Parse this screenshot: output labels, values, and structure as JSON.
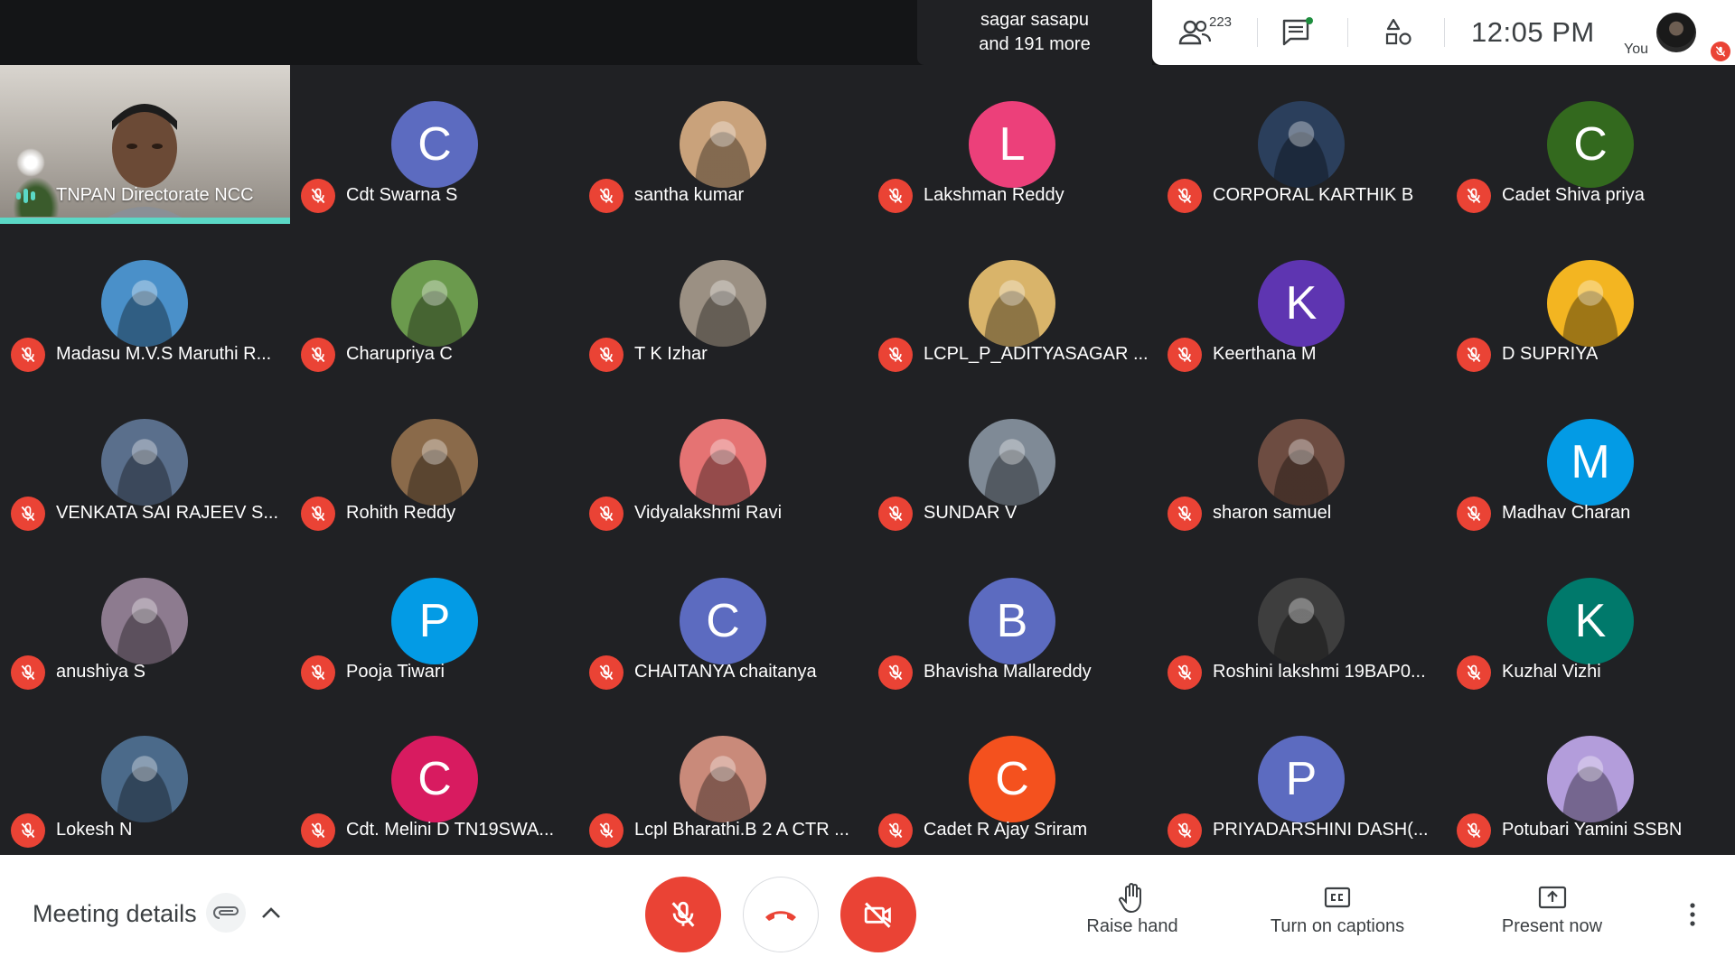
{
  "topbar": {
    "presenter_line1": "sagar sasapu",
    "presenter_line2": "and 191 more",
    "people_count": "223",
    "time": "12:05  PM",
    "you_label": "You",
    "icons": [
      "people-icon",
      "chat-icon",
      "activities-icon"
    ]
  },
  "self_tile": {
    "name": "TNPAN Directorate NCC"
  },
  "participants": [
    {
      "name": "Cdt Swarna S",
      "initial": "C",
      "color": "#5c6bc0"
    },
    {
      "name": "santha kumar",
      "initial": "",
      "color": "#c9a27b"
    },
    {
      "name": "Lakshman Reddy",
      "initial": "L",
      "color": "#ec407a"
    },
    {
      "name": "CORPORAL KARTHIK B",
      "initial": "",
      "color": "#2b3f5c"
    },
    {
      "name": "Cadet Shiva priya",
      "initial": "C",
      "color": "#33691e"
    },
    {
      "name": "Madasu M.V.S Maruthi R...",
      "initial": "",
      "color": "#4a90c9"
    },
    {
      "name": "Charupriya C",
      "initial": "",
      "color": "#6b9a4d"
    },
    {
      "name": "T K Izhar",
      "initial": "",
      "color": "#9b9083"
    },
    {
      "name": "LCPL_P_ADITYASAGAR ...",
      "initial": "",
      "color": "#d9b46a"
    },
    {
      "name": "Keerthana M",
      "initial": "K",
      "color": "#5e35b1"
    },
    {
      "name": "D SUPRIYA",
      "initial": "",
      "color": "#f3b521"
    },
    {
      "name": "VENKATA SAI RAJEEV S...",
      "initial": "",
      "color": "#5a6f8c"
    },
    {
      "name": "Rohith Reddy",
      "initial": "",
      "color": "#8a6a4a"
    },
    {
      "name": "Vidyalakshmi Ravi",
      "initial": "",
      "color": "#e57373"
    },
    {
      "name": "SUNDAR V",
      "initial": "",
      "color": "#7f8a96"
    },
    {
      "name": "sharon samuel",
      "initial": "",
      "color": "#6d4c41"
    },
    {
      "name": "Madhav Charan",
      "initial": "M",
      "color": "#039be5"
    },
    {
      "name": "anushiya S",
      "initial": "",
      "color": "#8d7b8f"
    },
    {
      "name": "Pooja Tiwari",
      "initial": "P",
      "color": "#039be5"
    },
    {
      "name": "CHAITANYA chaitanya",
      "initial": "C",
      "color": "#5c6bc0"
    },
    {
      "name": "Bhavisha Mallareddy",
      "initial": "B",
      "color": "#5c6bc0"
    },
    {
      "name": "Roshini lakshmi 19BAP0...",
      "initial": "",
      "color": "#3e3e3e"
    },
    {
      "name": "Kuzhal Vizhi",
      "initial": "K",
      "color": "#00796b"
    },
    {
      "name": "Lokesh N",
      "initial": "",
      "color": "#4b6a8a"
    },
    {
      "name": "Cdt. Melini D TN19SWA...",
      "initial": "C",
      "color": "#d81b60"
    },
    {
      "name": "Lcpl Bharathi.B 2 A CTR ...",
      "initial": "",
      "color": "#c98a7a"
    },
    {
      "name": "Cadet R Ajay Sriram",
      "initial": "C",
      "color": "#f4511e"
    },
    {
      "name": "PRIYADARSHINI DASH(...",
      "initial": "P",
      "color": "#5c6bc0"
    },
    {
      "name": "Potubari Yamini SSBN",
      "initial": "",
      "color": "#b39ddb"
    }
  ],
  "bottombar": {
    "meeting_details": "Meeting details",
    "raise_hand": "Raise hand",
    "captions": "Turn on captions",
    "present_now": "Present now"
  },
  "colors": {
    "accent_red": "#ea4335",
    "speaking": "#5bd8c6",
    "background": "#202124"
  }
}
